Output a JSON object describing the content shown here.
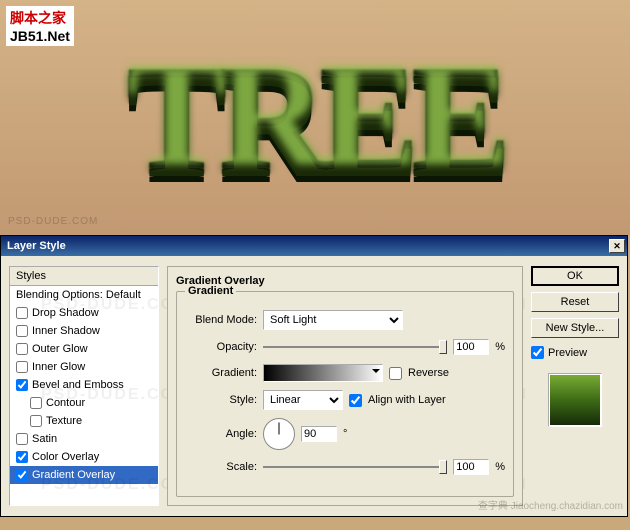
{
  "watermark": {
    "cn": "脚本之家",
    "en": "JB51.Net"
  },
  "canvas": {
    "text": "TREE",
    "dude": "PSD-DUDE.COM"
  },
  "dialog": {
    "title": "Layer Style",
    "styles_header": "Styles",
    "blending_default": "Blending Options: Default",
    "items": [
      {
        "label": "Drop Shadow",
        "checked": false,
        "sub": false
      },
      {
        "label": "Inner Shadow",
        "checked": false,
        "sub": false
      },
      {
        "label": "Outer Glow",
        "checked": false,
        "sub": false
      },
      {
        "label": "Inner Glow",
        "checked": false,
        "sub": false
      },
      {
        "label": "Bevel and Emboss",
        "checked": true,
        "sub": false
      },
      {
        "label": "Contour",
        "checked": false,
        "sub": true
      },
      {
        "label": "Texture",
        "checked": false,
        "sub": true
      },
      {
        "label": "Satin",
        "checked": false,
        "sub": false
      },
      {
        "label": "Color Overlay",
        "checked": true,
        "sub": false
      },
      {
        "label": "Gradient Overlay",
        "checked": true,
        "sub": false,
        "selected": true
      }
    ],
    "panel": {
      "title": "Gradient Overlay",
      "group": "Gradient",
      "blend_mode_label": "Blend Mode:",
      "blend_mode_value": "Soft Light",
      "opacity_label": "Opacity:",
      "opacity_value": "100",
      "percent": "%",
      "gradient_label": "Gradient:",
      "reverse_label": "Reverse",
      "style_label": "Style:",
      "style_value": "Linear",
      "align_label": "Align with Layer",
      "angle_label": "Angle:",
      "angle_value": "90",
      "degree": "°",
      "scale_label": "Scale:",
      "scale_value": "100"
    },
    "buttons": {
      "ok": "OK",
      "reset": "Reset",
      "new_style": "New Style...",
      "preview": "Preview"
    }
  },
  "corner": "查字典\nJiaocheng.chazidian.com"
}
